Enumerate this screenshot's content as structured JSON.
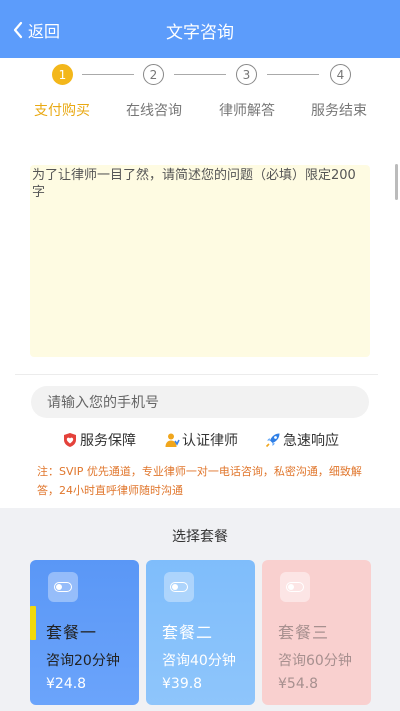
{
  "header": {
    "back_label": "返回",
    "title": "文字咨询"
  },
  "steps": [
    {
      "num": "1",
      "label": "支付购买",
      "active": true
    },
    {
      "num": "2",
      "label": "在线咨询",
      "active": false
    },
    {
      "num": "3",
      "label": "律师解答",
      "active": false
    },
    {
      "num": "4",
      "label": "服务结束",
      "active": false
    }
  ],
  "question": {
    "placeholder": "为了让律师一目了然，请简述您的问题（必填）限定200字",
    "value": ""
  },
  "phone": {
    "placeholder": "请输入您的手机号",
    "value": ""
  },
  "features": [
    {
      "icon": "shield-heart-icon",
      "label": "服务保障"
    },
    {
      "icon": "lawyer-icon",
      "label": "认证律师"
    },
    {
      "icon": "rocket-icon",
      "label": "急速响应"
    }
  ],
  "note": "注：SVIP 优先通道，专业律师一对一电话咨询，私密沟通，细致解答，24小时直呼律师随时沟通",
  "packages": {
    "title": "选择套餐",
    "items": [
      {
        "name": "套餐一",
        "desc": "咨询20分钟",
        "price": "¥24.8",
        "selected": true
      },
      {
        "name": "套餐二",
        "desc": "咨询40分钟",
        "price": "¥39.8",
        "selected": false
      },
      {
        "name": "套餐三",
        "desc": "咨询60分钟",
        "price": "¥54.8",
        "selected": false
      }
    ]
  },
  "colors": {
    "header": "#5c9cfb",
    "active_step": "#f3b71b",
    "note": "#e0762c"
  }
}
